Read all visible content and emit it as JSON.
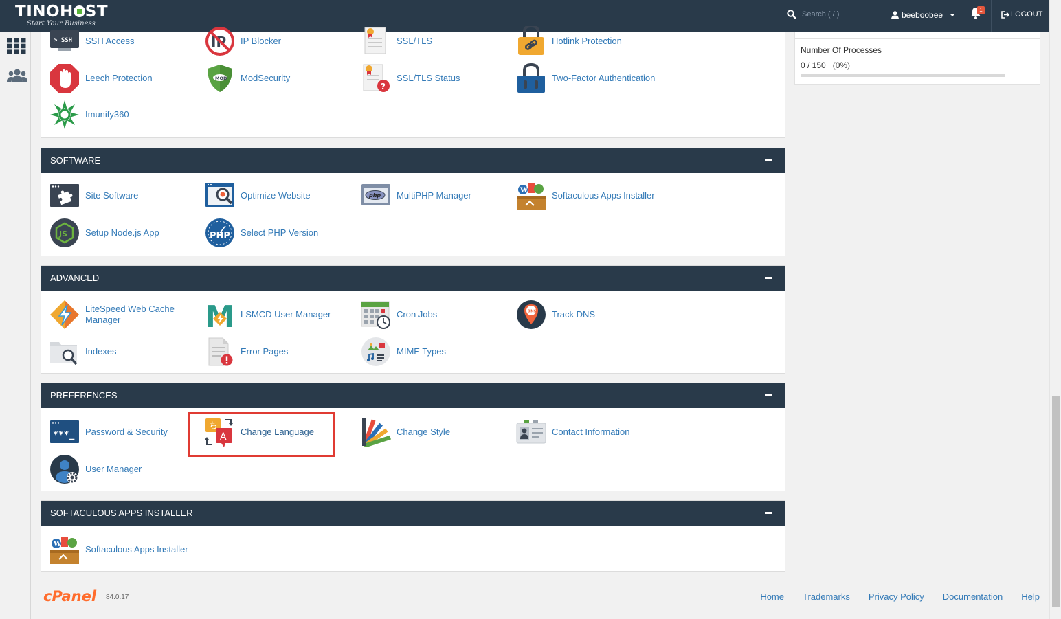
{
  "header": {
    "logo_text": "TINOH■ST",
    "logo_tagline": "Start Your Business",
    "search_placeholder": "Search ( / )",
    "username": "beeboobee",
    "notification_count": "1",
    "logout_label": "LOGOUT"
  },
  "security": {
    "items": [
      {
        "label": "SSH Access",
        "icon": "ssh-icon"
      },
      {
        "label": "IP Blocker",
        "icon": "ip-blocker-icon"
      },
      {
        "label": "SSL/TLS",
        "icon": "ssl-certificate-icon"
      },
      {
        "label": "Hotlink Protection",
        "icon": "hotlink-lock-icon"
      },
      {
        "label": "Leech Protection",
        "icon": "hand-stop-icon"
      },
      {
        "label": "ModSecurity",
        "icon": "shield-icon"
      },
      {
        "label": "SSL/TLS Status",
        "icon": "ssl-status-icon"
      },
      {
        "label": "Two-Factor Authentication",
        "icon": "padlock-icon"
      },
      {
        "label": "Imunify360",
        "icon": "imunify-icon"
      }
    ]
  },
  "software": {
    "title": "SOFTWARE",
    "items": [
      {
        "label": "Site Software",
        "icon": "puzzle-icon"
      },
      {
        "label": "Optimize Website",
        "icon": "magnifier-icon"
      },
      {
        "label": "MultiPHP Manager",
        "icon": "php-window-icon"
      },
      {
        "label": "Softaculous Apps Installer",
        "icon": "softaculous-icon"
      },
      {
        "label": "Setup Node.js App",
        "icon": "nodejs-icon"
      },
      {
        "label": "Select PHP Version",
        "icon": "php-gauge-icon"
      }
    ]
  },
  "advanced": {
    "title": "ADVANCED",
    "items": [
      {
        "label": "LiteSpeed Web Cache Manager",
        "icon": "litespeed-icon"
      },
      {
        "label": "LSMCD User Manager",
        "icon": "lsmcd-icon"
      },
      {
        "label": "Cron Jobs",
        "icon": "calendar-clock-icon"
      },
      {
        "label": "Track DNS",
        "icon": "dns-pin-icon"
      },
      {
        "label": "Indexes",
        "icon": "folder-search-icon"
      },
      {
        "label": "Error Pages",
        "icon": "error-page-icon"
      },
      {
        "label": "MIME Types",
        "icon": "mime-icon"
      }
    ]
  },
  "preferences": {
    "title": "PREFERENCES",
    "items": [
      {
        "label": "Password & Security",
        "icon": "password-icon"
      },
      {
        "label": "Change Language",
        "icon": "language-icon"
      },
      {
        "label": "Change Style",
        "icon": "palette-icon"
      },
      {
        "label": "Contact Information",
        "icon": "contact-card-icon"
      },
      {
        "label": "User Manager",
        "icon": "user-gear-icon"
      }
    ]
  },
  "softaculous_section": {
    "title": "SOFTACULOUS APPS INSTALLER",
    "items": [
      {
        "label": "Softaculous Apps Installer",
        "icon": "softaculous-icon"
      }
    ]
  },
  "stats": {
    "title": "Number Of Processes",
    "value": "0 / 150   (0%)",
    "fraction": 0.0
  },
  "footer": {
    "brand": "cPanel",
    "version": "84.0.17",
    "links": [
      "Home",
      "Trademarks",
      "Privacy Policy",
      "Documentation",
      "Help"
    ]
  },
  "colors": {
    "header_bg": "#293a4a",
    "link": "#337ab7",
    "highlight": "#e03b33",
    "cpanel_orange": "#ff6c2c"
  }
}
